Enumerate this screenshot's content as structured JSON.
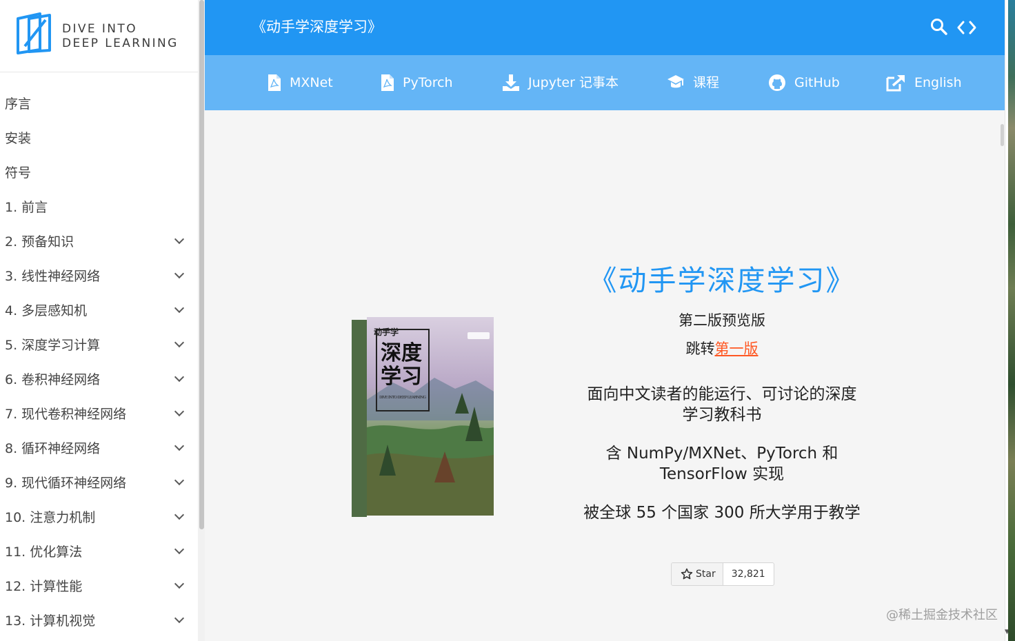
{
  "logo": {
    "line1": "DIVE INTO",
    "line2": "DEEP LEARNING"
  },
  "sidebar": {
    "items": [
      {
        "label": "序言",
        "expandable": false
      },
      {
        "label": "安装",
        "expandable": false
      },
      {
        "label": "符号",
        "expandable": false
      },
      {
        "label": "1. 前言",
        "expandable": false
      },
      {
        "label": "2. 预备知识",
        "expandable": true
      },
      {
        "label": "3. 线性神经网络",
        "expandable": true
      },
      {
        "label": "4. 多层感知机",
        "expandable": true
      },
      {
        "label": "5. 深度学习计算",
        "expandable": true
      },
      {
        "label": "6. 卷积神经网络",
        "expandable": true
      },
      {
        "label": "7. 现代卷积神经网络",
        "expandable": true
      },
      {
        "label": "8. 循环神经网络",
        "expandable": true
      },
      {
        "label": "9. 现代循环神经网络",
        "expandable": true
      },
      {
        "label": "10. 注意力机制",
        "expandable": true
      },
      {
        "label": "11. 优化算法",
        "expandable": true
      },
      {
        "label": "12. 计算性能",
        "expandable": true
      },
      {
        "label": "13. 计算机视觉",
        "expandable": true
      }
    ]
  },
  "header": {
    "title": "《动手学深度学习》",
    "icons": [
      "search-icon",
      "code-icon"
    ]
  },
  "nav_links": [
    {
      "label": "MXNet",
      "icon": "pdf-icon"
    },
    {
      "label": "PyTorch",
      "icon": "pdf-icon"
    },
    {
      "label": "Jupyter 记事本",
      "icon": "download-icon"
    },
    {
      "label": "课程",
      "icon": "graduation-cap-icon"
    },
    {
      "label": "GitHub",
      "icon": "github-icon"
    },
    {
      "label": "English",
      "icon": "external-link-icon"
    }
  ],
  "book_cover": {
    "title_top": "动手学",
    "title_main1": "深度",
    "title_main2": "学习",
    "subtitle": "DIVE INTO DEEP LEARNING"
  },
  "hero": {
    "title": "《动手学深度学习》",
    "edition": "第二版预览版",
    "jump_prefix": "跳转",
    "jump_link": "第一版",
    "desc1": "面向中文读者的能运行、可讨论的深度学习教科书",
    "desc2": "含 NumPy/MXNet、PyTorch 和 TensorFlow 实现",
    "desc3": "被全球 55 个国家 300 所大学用于教学"
  },
  "github_star": {
    "label": "Star",
    "count": "32,821"
  },
  "watermark": "@稀土掘金技术社区",
  "colors": {
    "header": "#2196f3",
    "subheader": "#64b5f6",
    "hero_title": "#2196f3",
    "link": "#ff5722",
    "content_bg": "#f5f5f5"
  }
}
